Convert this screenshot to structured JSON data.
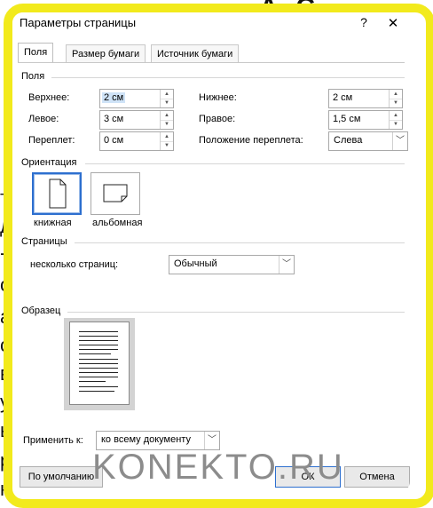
{
  "background": {
    "title": "А. С. Пушкин",
    "letters": [
      "то",
      "д",
      "-",
      "о",
      "а",
      "с",
      "в",
      "у",
      "ы",
      "р",
      "н"
    ]
  },
  "dialog": {
    "title": "Параметры страницы",
    "help": "?",
    "close": "✕"
  },
  "tabs": [
    "Поля",
    "Размер бумаги",
    "Источник бумаги"
  ],
  "margins": {
    "section": "Поля",
    "top_label": "Верхнее:",
    "top_value": "2 см",
    "bottom_label": "Нижнее:",
    "bottom_value": "2 см",
    "left_label": "Левое:",
    "left_value": "3 см",
    "right_label": "Правое:",
    "right_value": "1,5 см",
    "gutter_label": "Переплет:",
    "gutter_value": "0 см",
    "gutter_pos_label": "Положение переплета:",
    "gutter_pos_value": "Слева"
  },
  "orientation": {
    "section": "Ориентация",
    "portrait": "книжная",
    "landscape": "альбомная"
  },
  "pages": {
    "section": "Страницы",
    "multiple_label": "несколько страниц:",
    "multiple_value": "Обычный"
  },
  "sample": {
    "section": "Образец"
  },
  "apply": {
    "label": "Применить к:",
    "value": "ко всему документу"
  },
  "buttons": {
    "default": "По умолчанию",
    "ok": "ОК",
    "cancel": "Отмена"
  },
  "watermark": "KONEKTO.RU",
  "colors": {
    "frame": "#f2ea1c",
    "accent": "#2d6fcf"
  }
}
